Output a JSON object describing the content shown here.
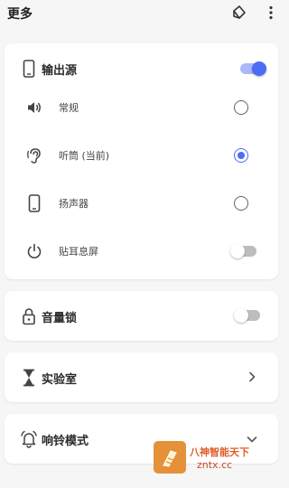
{
  "header": {
    "title": "更多"
  },
  "output_card": {
    "title": "输出源",
    "enabled": true,
    "options": [
      {
        "label": "常规",
        "selected": false
      },
      {
        "label": "听筒 (当前)",
        "selected": true
      },
      {
        "label": "扬声器",
        "selected": false
      }
    ],
    "proximity": {
      "label": "贴耳息屏",
      "enabled": false
    }
  },
  "volume_lock": {
    "label": "音量锁",
    "enabled": false
  },
  "lab": {
    "label": "实验室"
  },
  "ringtone_mode": {
    "label": "响铃模式"
  },
  "watermark": {
    "line1": "八神智能天下",
    "line2": "zntx.cc"
  },
  "colors": {
    "accent": "#4a6cf7",
    "background": "#f6f6f6",
    "card": "#ffffff"
  },
  "icons": [
    "tag-icon",
    "more-vert-icon",
    "phone-icon",
    "speaker-icon",
    "ear-icon",
    "phone-speaker-icon",
    "power-icon",
    "lock-icon",
    "hourglass-icon",
    "chevron-right-icon",
    "alarm-icon",
    "chevron-down-icon"
  ]
}
